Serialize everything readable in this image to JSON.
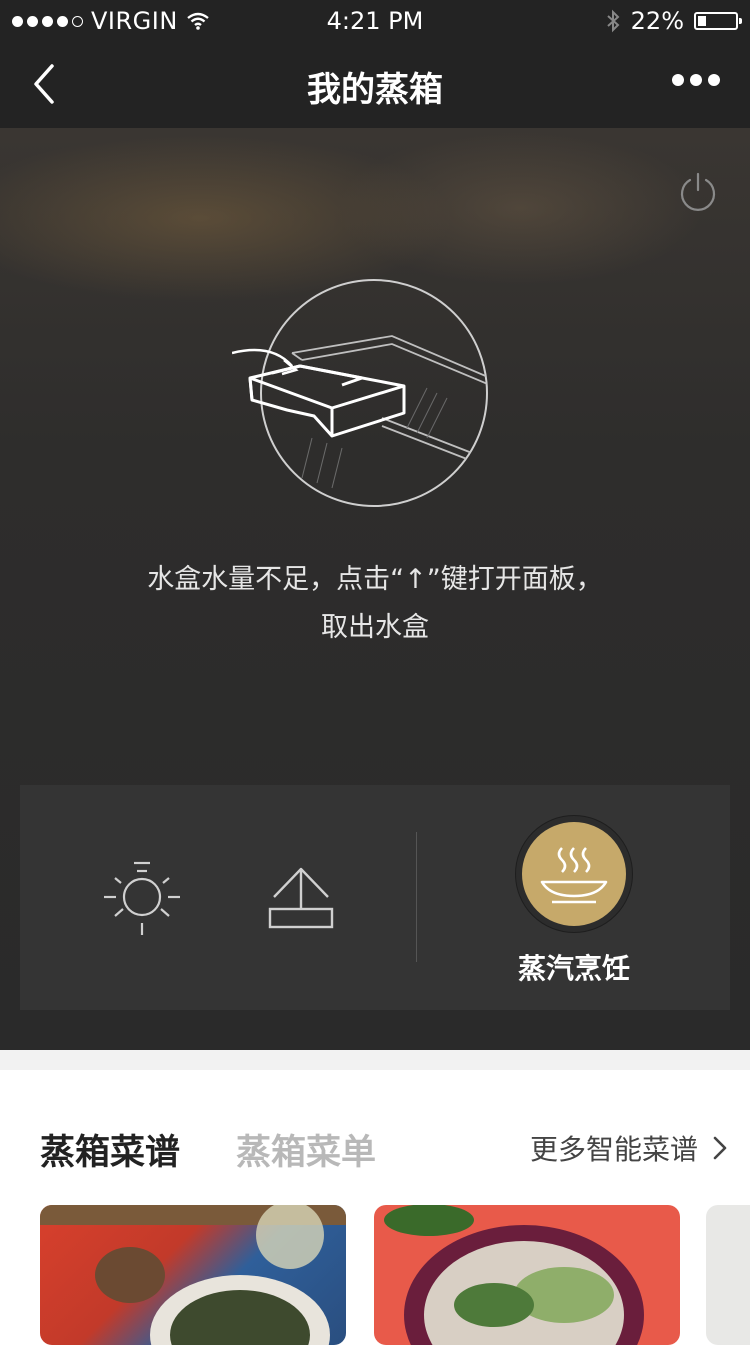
{
  "status_bar": {
    "carrier": "VIRGIN",
    "time": "4:21 PM",
    "battery": "22%",
    "battery_level": 0.22
  },
  "nav": {
    "title": "我的蒸箱"
  },
  "hero": {
    "warning_line1": "水盒水量不足，点击“↑”键打开面板，",
    "warning_line2": "取出水盒"
  },
  "controls": {
    "steam_mode_label": "蒸汽烹饪"
  },
  "tabs": {
    "active": "蒸箱菜谱",
    "inactive": "蒸箱菜单",
    "more": "更多智能菜谱"
  },
  "colors": {
    "accent_gold": "#c6a96a",
    "header_bg": "#232323"
  }
}
